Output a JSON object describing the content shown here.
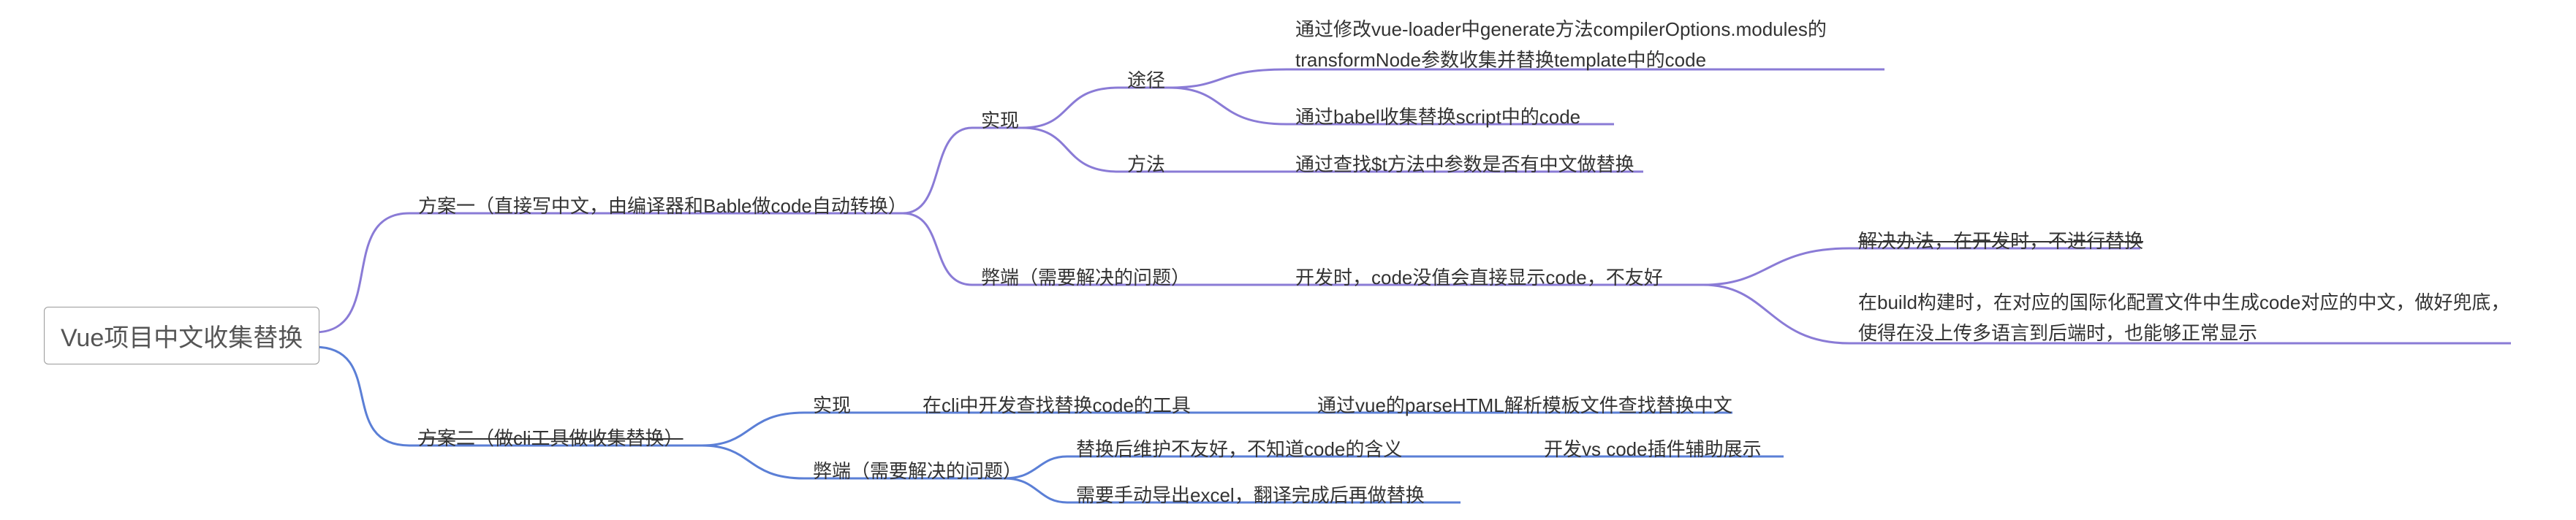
{
  "root": {
    "label": "Vue项目中文收集替换"
  },
  "plan1": {
    "label": "方案一（直接写中文，由编译器和Bable做code自动转换）",
    "impl": {
      "label": "实现",
      "way": {
        "label": "途径",
        "a": "通过修改vue-loader中generate方法compilerOptions.modules的transformNode参数收集并替换template中的code",
        "b": "通过babel收集替换script中的code"
      },
      "method": {
        "label": "方法",
        "a": "通过查找$t方法中参数是否有中文做替换"
      }
    },
    "cons": {
      "label": "弊端（需要解决的问题）",
      "a": "开发时，code没值会直接显示code，不友好",
      "fix1": "解决办法，在开发时，不进行替换",
      "fix2": "在build构建时，在对应的国际化配置文件中生成code对应的中文，做好兜底，使得在没上传多语言到后端时，也能够正常显示"
    }
  },
  "plan2": {
    "label": "方案二（做cli工具做收集替换）",
    "impl": {
      "label": "实现",
      "a": "在cli中开发查找替换code的工具",
      "a1": "通过vue的parseHTML解析模板文件查找替换中文"
    },
    "cons": {
      "label": "弊端（需要解决的问题）",
      "a": "替换后维护不友好，不知道code的含义",
      "a1": "开发vs code插件辅助展示",
      "b": "需要手动导出excel，翻译完成后再做替换"
    }
  }
}
